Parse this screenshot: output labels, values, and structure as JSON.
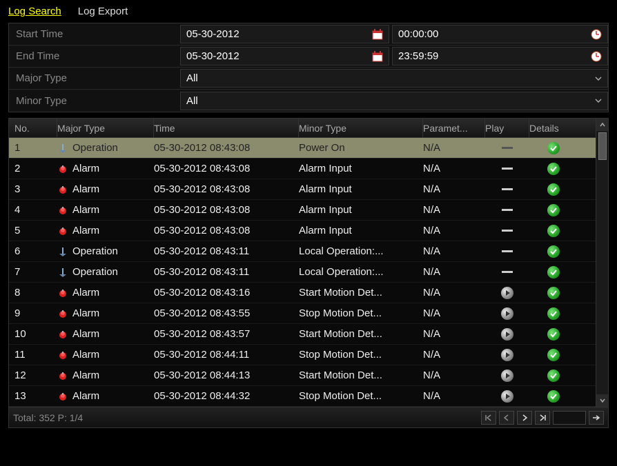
{
  "tabs": {
    "log_search": "Log Search",
    "log_export": "Log Export"
  },
  "filters": {
    "start_label": "Start Time",
    "start_date": "05-30-2012",
    "start_time": "00:00:00",
    "end_label": "End Time",
    "end_date": "05-30-2012",
    "end_time": "23:59:59",
    "major_label": "Major Type",
    "major_value": "All",
    "minor_label": "Minor Type",
    "minor_value": "All"
  },
  "columns": {
    "no": "No.",
    "major": "Major Type",
    "time": "Time",
    "minor": "Minor Type",
    "param": "Paramet...",
    "play": "Play",
    "details": "Details"
  },
  "rows": [
    {
      "no": "1",
      "type": "operation",
      "major": "Operation",
      "time": "05-30-2012 08:43:08",
      "minor": "Power On",
      "param": "N/A",
      "play": "dash",
      "selected": true
    },
    {
      "no": "2",
      "type": "alarm",
      "major": "Alarm",
      "time": "05-30-2012 08:43:08",
      "minor": "Alarm Input",
      "param": "N/A",
      "play": "dash"
    },
    {
      "no": "3",
      "type": "alarm",
      "major": "Alarm",
      "time": "05-30-2012 08:43:08",
      "minor": "Alarm Input",
      "param": "N/A",
      "play": "dash"
    },
    {
      "no": "4",
      "type": "alarm",
      "major": "Alarm",
      "time": "05-30-2012 08:43:08",
      "minor": "Alarm Input",
      "param": "N/A",
      "play": "dash"
    },
    {
      "no": "5",
      "type": "alarm",
      "major": "Alarm",
      "time": "05-30-2012 08:43:08",
      "minor": "Alarm Input",
      "param": "N/A",
      "play": "dash"
    },
    {
      "no": "6",
      "type": "operation",
      "major": "Operation",
      "time": "05-30-2012 08:43:11",
      "minor": "Local Operation:...",
      "param": "N/A",
      "play": "dash"
    },
    {
      "no": "7",
      "type": "operation",
      "major": "Operation",
      "time": "05-30-2012 08:43:11",
      "minor": "Local Operation:...",
      "param": "N/A",
      "play": "dash"
    },
    {
      "no": "8",
      "type": "alarm",
      "major": "Alarm",
      "time": "05-30-2012 08:43:16",
      "minor": "Start Motion Det...",
      "param": "N/A",
      "play": "play"
    },
    {
      "no": "9",
      "type": "alarm",
      "major": "Alarm",
      "time": "05-30-2012 08:43:55",
      "minor": "Stop Motion Det...",
      "param": "N/A",
      "play": "play"
    },
    {
      "no": "10",
      "type": "alarm",
      "major": "Alarm",
      "time": "05-30-2012 08:43:57",
      "minor": "Start Motion Det...",
      "param": "N/A",
      "play": "play"
    },
    {
      "no": "11",
      "type": "alarm",
      "major": "Alarm",
      "time": "05-30-2012 08:44:11",
      "minor": "Stop Motion Det...",
      "param": "N/A",
      "play": "play"
    },
    {
      "no": "12",
      "type": "alarm",
      "major": "Alarm",
      "time": "05-30-2012 08:44:13",
      "minor": "Start Motion Det...",
      "param": "N/A",
      "play": "play"
    },
    {
      "no": "13",
      "type": "alarm",
      "major": "Alarm",
      "time": "05-30-2012 08:44:32",
      "minor": "Stop Motion Det...",
      "param": "N/A",
      "play": "play"
    }
  ],
  "footer": {
    "total_text": "Total: 352  P: 1/4"
  }
}
